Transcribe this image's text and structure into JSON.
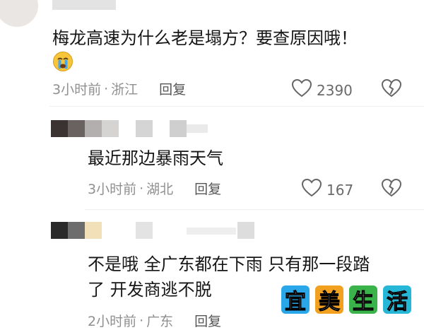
{
  "comments": [
    {
      "text": "梅龙高速为什么老是塌方？要查原因哦！",
      "emoji": "😭",
      "time": "3小时前",
      "location": "浙江",
      "reply_label": "回复",
      "likes": "2390"
    },
    {
      "text": "最近那边暴雨天气",
      "time": "3小时前",
      "location": "湖北",
      "reply_label": "回复",
      "likes": "167"
    },
    {
      "text_line1": "不是哦 全广东都在下雨 只有那一段踏",
      "text_line2": "了 开发商逃不脱",
      "time": "2小时前",
      "location": "广东",
      "reply_label": "回复"
    }
  ],
  "separator": "·",
  "watermark": {
    "chars": [
      "宜",
      "美",
      "生",
      "活"
    ],
    "colors": [
      "#2aa7e8",
      "#f2a020",
      "#3ab34a",
      "#27b7d6"
    ]
  },
  "icons": {
    "like": "heart-outline-icon",
    "dislike": "broken-heart-icon",
    "emoji": "crying-face-emoji"
  }
}
